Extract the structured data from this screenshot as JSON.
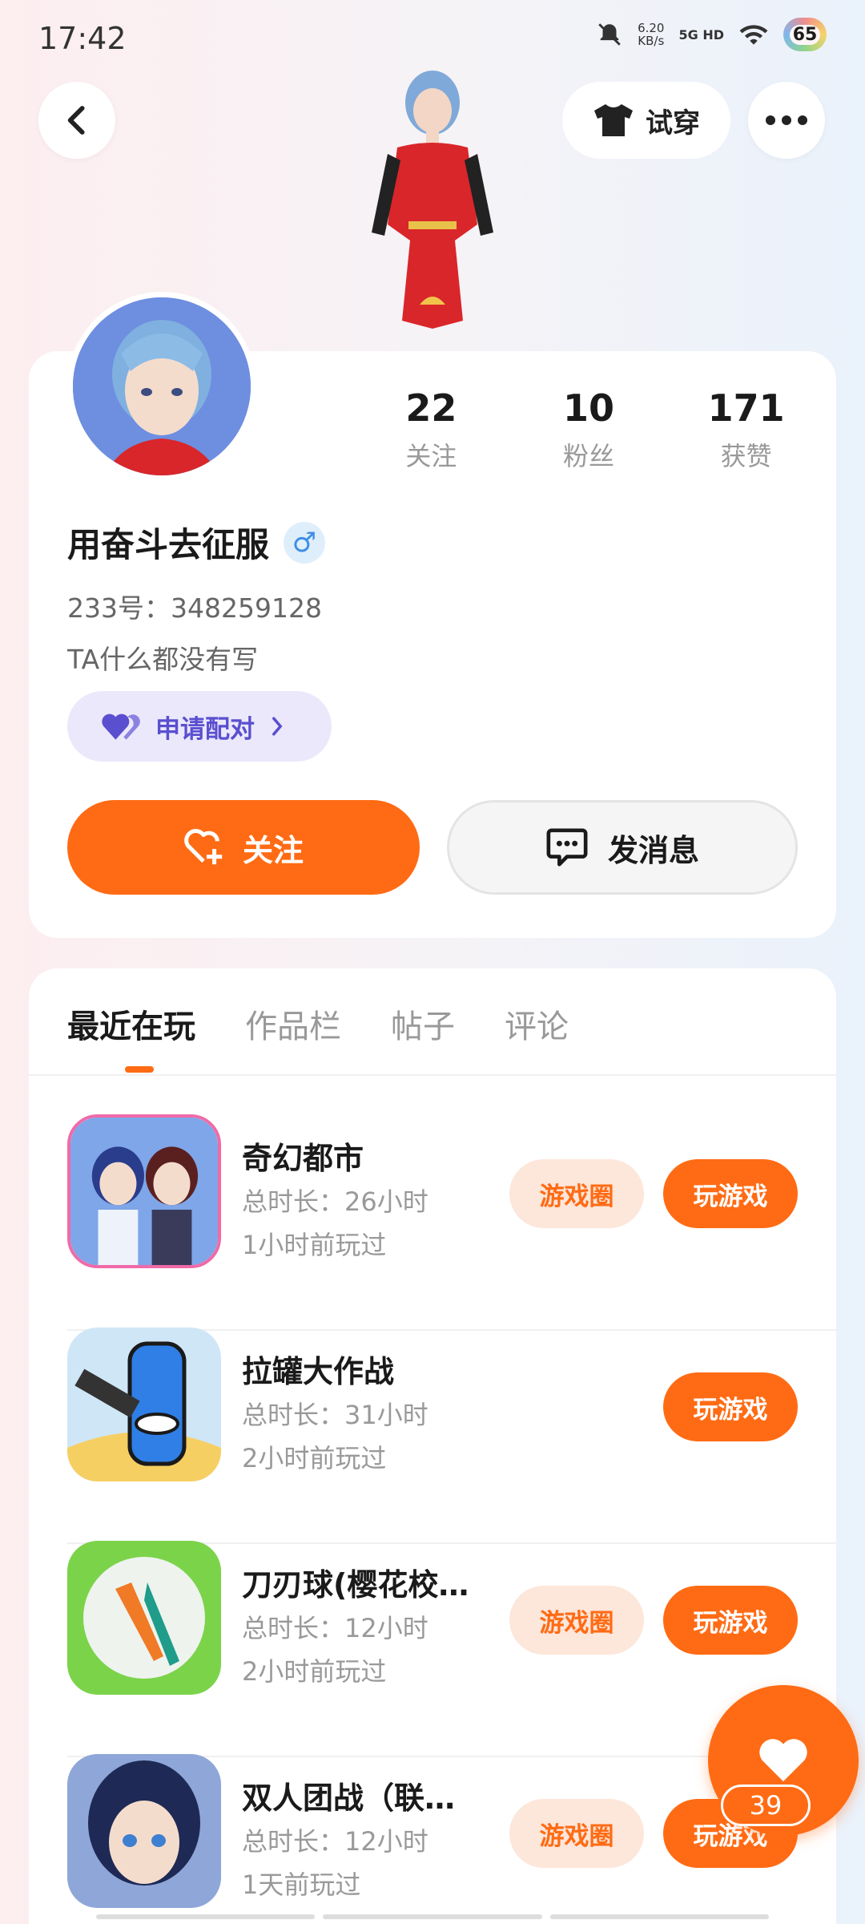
{
  "status_bar": {
    "time": "17:42",
    "net_speed_value": "6.20",
    "net_speed_unit": "KB/s",
    "signal": "5G HD",
    "battery": "65"
  },
  "top_nav": {
    "tryon_label": "试穿"
  },
  "profile": {
    "stats": [
      {
        "num": "22",
        "label": "关注"
      },
      {
        "num": "10",
        "label": "粉丝"
      },
      {
        "num": "171",
        "label": "获赞"
      }
    ],
    "username": "用奋斗去征服",
    "gender_symbol": "♂",
    "uid": "233号：348259128",
    "bio": "TA什么都没有写",
    "pair_label": "申请配对",
    "follow_label": "关注",
    "message_label": "发消息"
  },
  "tabs": [
    "最近在玩",
    "作品栏",
    "帖子",
    "评论"
  ],
  "games": [
    {
      "name": "奇幻都市",
      "duration": "总时长：26小时",
      "last_played": "1小时前玩过",
      "circle_label": "游戏圈",
      "play_label": "玩游戏"
    },
    {
      "name": "拉罐大作战",
      "duration": "总时长：31小时",
      "last_played": "2小时前玩过",
      "circle_label": "",
      "play_label": "玩游戏"
    },
    {
      "name": "刀刃球(樱花校…",
      "duration": "总时长：12小时",
      "last_played": "2小时前玩过",
      "circle_label": "游戏圈",
      "play_label": "玩游戏"
    },
    {
      "name": "双人团战（联…",
      "duration": "总时长：12小时",
      "last_played": "1天前玩过",
      "circle_label": "游戏圈",
      "play_label": "玩游戏"
    }
  ],
  "like_fab": {
    "count": "39"
  },
  "colors": {
    "accent": "#ff6b14",
    "pair_text": "#5a4fcf",
    "pair_bg": "#ebe8fb"
  }
}
